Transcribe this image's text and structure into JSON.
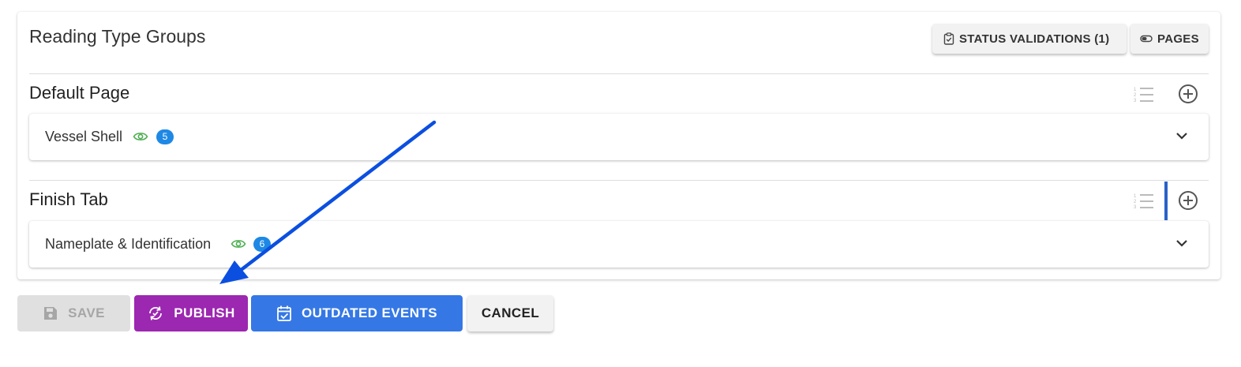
{
  "header": {
    "title": "Reading Type Groups",
    "status_validations_label": "STATUS VALIDATIONS (1)",
    "pages_label": "PAGES"
  },
  "sections": [
    {
      "title": "Default Page",
      "groups": [
        {
          "name": "Vessel Shell",
          "badge": "5"
        }
      ]
    },
    {
      "title": "Finish Tab",
      "groups": [
        {
          "name": "Nameplate & Identification",
          "badge": "6"
        }
      ]
    }
  ],
  "actions": {
    "save_label": "SAVE",
    "publish_label": "PUBLISH",
    "outdated_label": "OUTDATED EVENTS",
    "cancel_label": "CANCEL"
  },
  "colors": {
    "publish": "#9c27b0",
    "outdated": "#3578e5",
    "badge": "#1e88e5",
    "eye": "#4caf50",
    "arrow": "#0b4fe0"
  },
  "icons": {
    "status_validations": "clipboard-check-icon",
    "pages": "toggle-icon",
    "sort": "ordered-list-icon",
    "add": "plus-circle-icon",
    "visible": "eye-icon",
    "expand": "chevron-down-icon",
    "save": "floppy-disk-icon",
    "publish": "sync-check-icon",
    "outdated": "calendar-check-icon"
  }
}
